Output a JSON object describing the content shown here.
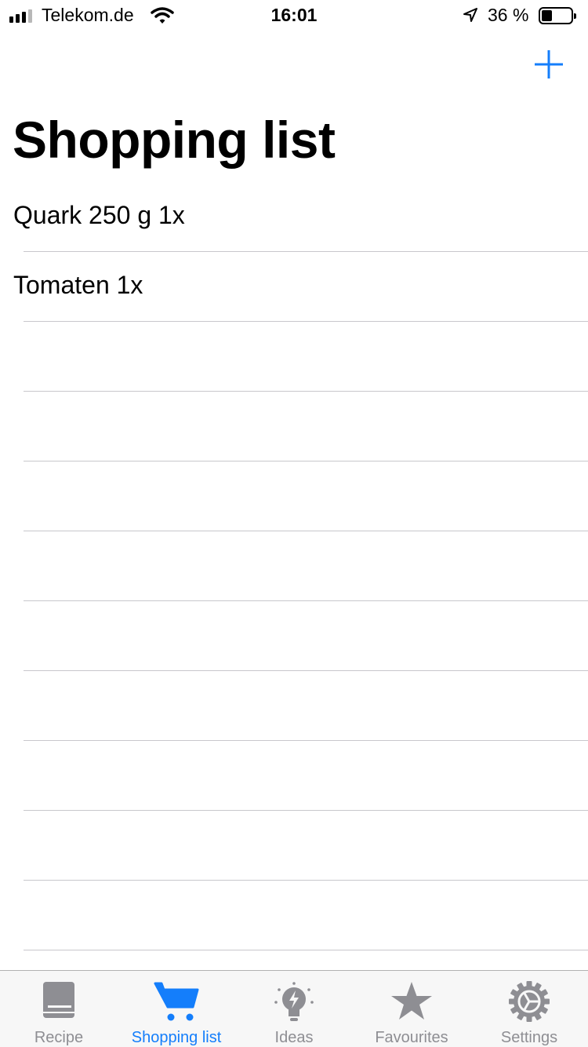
{
  "status_bar": {
    "carrier": "Telekom.de",
    "time": "16:01",
    "battery_text": "36 %",
    "battery_level": 0.36
  },
  "nav": {
    "title": "Shopping list",
    "add_icon": "plus-icon"
  },
  "items": [
    {
      "label": "Quark 250 g 1x"
    },
    {
      "label": "Tomaten 1x"
    }
  ],
  "tabs": [
    {
      "label": "Recipe",
      "icon": "book-icon",
      "active": false
    },
    {
      "label": "Shopping list",
      "icon": "cart-icon",
      "active": true
    },
    {
      "label": "Ideas",
      "icon": "lightbulb-icon",
      "active": false
    },
    {
      "label": "Favourites",
      "icon": "star-icon",
      "active": false
    },
    {
      "label": "Settings",
      "icon": "gear-icon",
      "active": false
    }
  ],
  "colors": {
    "accent": "#147efb",
    "inactive": "#8e8e93",
    "separator": "#c8c7cc"
  }
}
